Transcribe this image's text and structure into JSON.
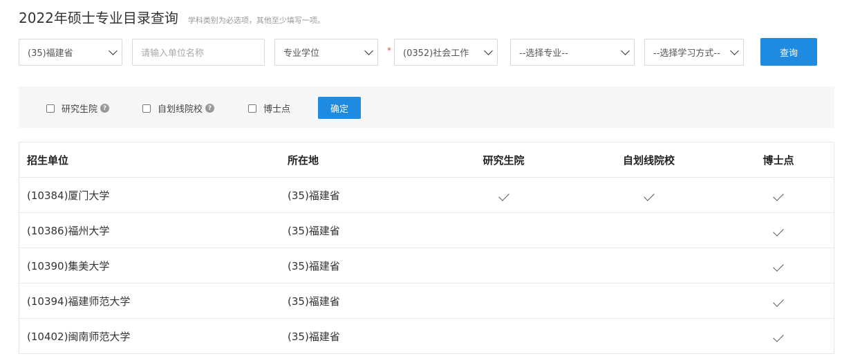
{
  "header": {
    "title": "2022年硕士专业目录查询",
    "hint": "学科类别为必选项，其他至少填写一项。"
  },
  "filters": {
    "province": "(35)福建省",
    "unit_placeholder": "请输入单位名称",
    "degree_type": "专业学位",
    "discipline": "(0352)社会工作",
    "major": "--选择专业--",
    "study_mode": "--选择学习方式--",
    "required_mark": "*",
    "query_label": "查询"
  },
  "options": {
    "graduate_school": "研究生院",
    "self_line": "自划线院校",
    "doctoral": "博士点",
    "help_glyph": "?",
    "confirm_label": "确定"
  },
  "table": {
    "columns": [
      "招生单位",
      "所在地",
      "研究生院",
      "自划线院校",
      "博士点"
    ],
    "rows": [
      {
        "unit": "(10384)厦门大学",
        "location": "(35)福建省",
        "graduate_school": true,
        "self_line": true,
        "doctoral": true
      },
      {
        "unit": "(10386)福州大学",
        "location": "(35)福建省",
        "graduate_school": false,
        "self_line": false,
        "doctoral": true
      },
      {
        "unit": "(10390)集美大学",
        "location": "(35)福建省",
        "graduate_school": false,
        "self_line": false,
        "doctoral": true
      },
      {
        "unit": "(10394)福建师范大学",
        "location": "(35)福建省",
        "graduate_school": false,
        "self_line": false,
        "doctoral": true
      },
      {
        "unit": "(10402)闽南师范大学",
        "location": "(35)福建省",
        "graduate_school": false,
        "self_line": false,
        "doctoral": true
      }
    ]
  },
  "colors": {
    "accent": "#1e8be0",
    "required": "#e25050",
    "filter_bg": "#f5f6f8"
  },
  "icons": {
    "check": "checkmark-icon",
    "help": "question-circle-icon",
    "select": "chevron-down-icon"
  }
}
